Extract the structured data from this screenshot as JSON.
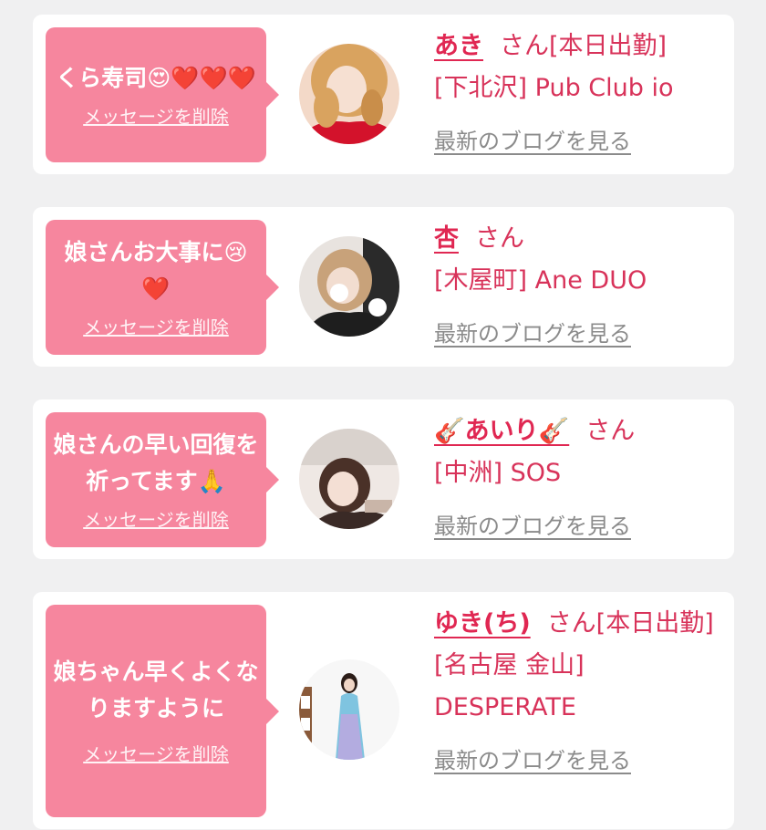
{
  "cards": [
    {
      "message_text": "くら寿司",
      "message_emoji": "😍❤️❤️❤️",
      "delete_label": "メッセージを削除",
      "name": "あき",
      "honorific": "さん[本日出勤]",
      "store": "[下北沢] Pub Club io",
      "blog_label": "最新のブログを見る"
    },
    {
      "message_text": "娘さんお大事に",
      "message_emoji": "😢❤️",
      "delete_label": "メッセージを削除",
      "name": "杏",
      "honorific": "さん",
      "store": "[木屋町] Ane DUO",
      "blog_label": "最新のブログを見る"
    },
    {
      "message_text": "娘さんの早い回復を祈ってます",
      "message_emoji": "🙏",
      "delete_label": "メッセージを削除",
      "name": "🎸あいり🎸",
      "honorific": "さん",
      "store": "[中洲] SOS",
      "blog_label": "最新のブログを見る"
    },
    {
      "message_text": "娘ちゃん早くよくなりますように",
      "message_emoji": "",
      "delete_label": "メッセージを削除",
      "name": "ゆき(ち)",
      "honorific": "さん[本日出勤]",
      "store": "[名古屋 金山] DESPERATE",
      "blog_label": "最新のブログを見る"
    }
  ],
  "colors": {
    "page_bg": "#f0f0f1",
    "card_bg": "#ffffff",
    "bubble": "#f6869e",
    "name": "#e02752",
    "text": "#d8335a",
    "link_gray": "#8b8b8b"
  },
  "icons": [
    "avatar-photo",
    "heart-eyes-emoji",
    "heart-emoji",
    "crying-emoji",
    "praying-hands-emoji",
    "guitar-emoji"
  ]
}
